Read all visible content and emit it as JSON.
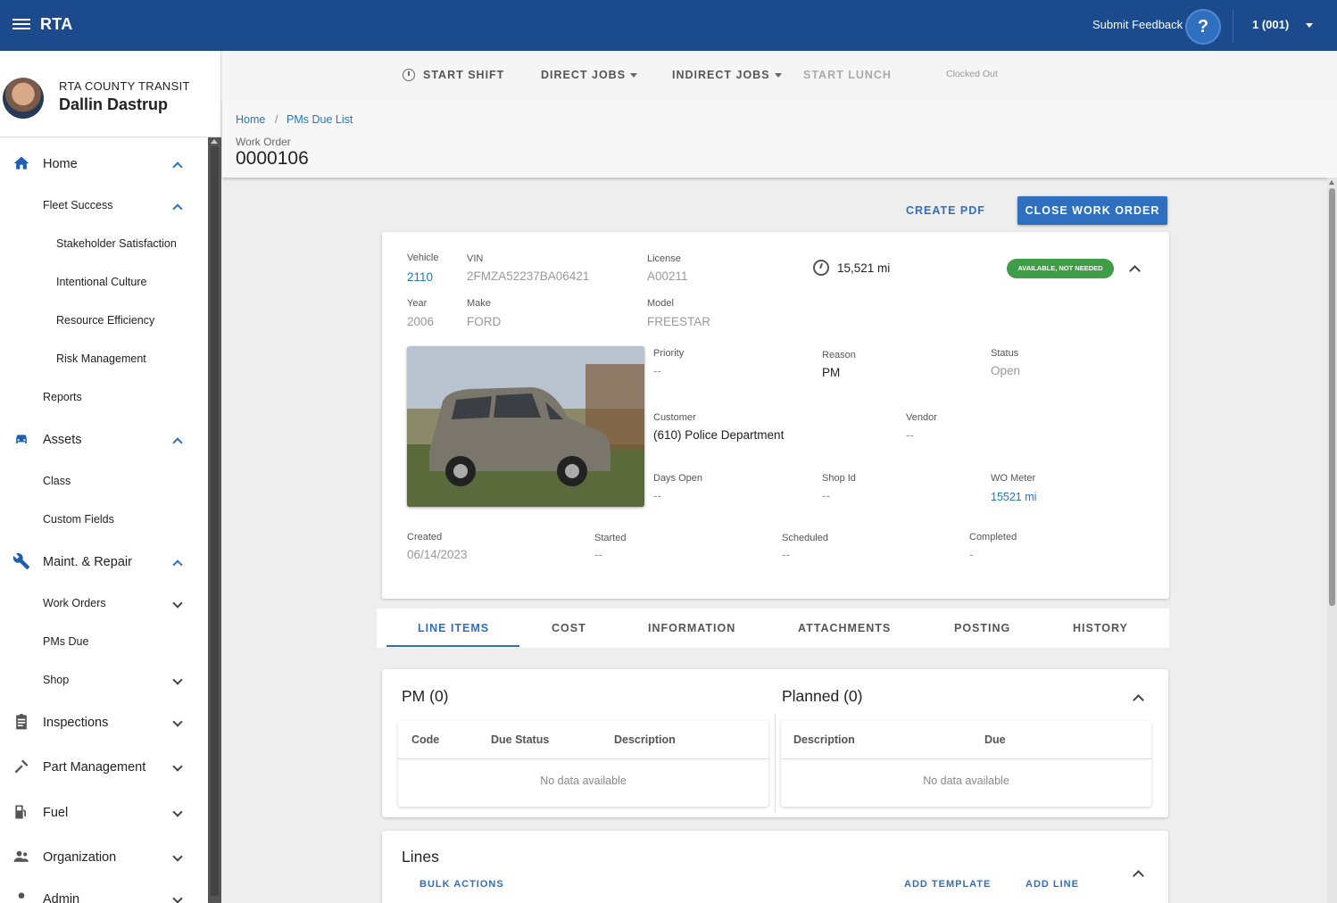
{
  "app": {
    "title": "RTA"
  },
  "topbar": {
    "feedback": "Submit Feedback",
    "account": "1 (001)"
  },
  "profile": {
    "org": "RTA COUNTY TRANSIT",
    "user": "Dallin Dastrup"
  },
  "sidebar": {
    "items": [
      {
        "label": "Home"
      },
      {
        "label": "Fleet Success"
      },
      {
        "label": "Stakeholder Satisfaction"
      },
      {
        "label": "Intentional Culture"
      },
      {
        "label": "Resource Efficiency"
      },
      {
        "label": "Risk Management"
      },
      {
        "label": "Reports"
      },
      {
        "label": "Assets"
      },
      {
        "label": "Class"
      },
      {
        "label": "Custom Fields"
      },
      {
        "label": "Maint. & Repair"
      },
      {
        "label": "Work Orders"
      },
      {
        "label": "PMs Due"
      },
      {
        "label": "Shop"
      },
      {
        "label": "Inspections"
      },
      {
        "label": "Part Management"
      },
      {
        "label": "Fuel"
      },
      {
        "label": "Organization"
      },
      {
        "label": "Admin"
      }
    ]
  },
  "actions": {
    "start_shift": "START SHIFT",
    "direct_jobs": "DIRECT JOBS",
    "indirect_jobs": "INDIRECT JOBS",
    "start_lunch": "START LUNCH",
    "clocked": "Clocked Out"
  },
  "breadcrumb": {
    "home": "Home",
    "sep": "/",
    "current": "PMs Due List"
  },
  "work_order": {
    "label": "Work Order",
    "number": "0000106",
    "create_pdf": "CREATE PDF",
    "close": "CLOSE WORK ORDER"
  },
  "vehicle": {
    "vehicle_label": "Vehicle",
    "vehicle": "2110",
    "vin_label": "VIN",
    "vin": "2FMZA52237BA06421",
    "license_label": "License",
    "license": "A00211",
    "meter": "15,521 mi",
    "status": "AVAILABLE, NOT NEEDED",
    "year_label": "Year",
    "year": "2006",
    "make_label": "Make",
    "make": "FORD",
    "model_label": "Model",
    "model": "FREESTAR"
  },
  "details": {
    "priority_label": "Priority",
    "priority": "--",
    "reason_label": "Reason",
    "reason": "PM",
    "status_label": "Status",
    "status": "Open",
    "customer_label": "Customer",
    "customer": "(610) Police Department",
    "vendor_label": "Vendor",
    "vendor": "--",
    "days_open_label": "Days Open",
    "days_open": "--",
    "shop_label": "Shop Id",
    "shop": "--",
    "wo_meter_label": "WO Meter",
    "wo_meter": "15521 mi",
    "created_label": "Created",
    "created": "06/14/2023",
    "started_label": "Started",
    "started": "--",
    "scheduled_label": "Scheduled",
    "scheduled": "--",
    "completed_label": "Completed",
    "completed": "-"
  },
  "tabs": [
    "LINE ITEMS",
    "COST",
    "INFORMATION",
    "ATTACHMENTS",
    "POSTING",
    "HISTORY"
  ],
  "pm": {
    "title": "PM (0)",
    "columns": [
      "Code",
      "Due Status",
      "Description"
    ],
    "empty": "No data available"
  },
  "planned": {
    "title": "Planned (0)",
    "columns": [
      "Description",
      "Due"
    ],
    "empty": "No data available"
  },
  "lines": {
    "title": "Lines",
    "bulk": "BULK ACTIONS",
    "add_template": "ADD TEMPLATE",
    "add_line": "ADD LINE"
  },
  "colors": {
    "brand": "#1b4b8c",
    "accent": "#2f6fc0",
    "status_green": "#3e9d46"
  }
}
